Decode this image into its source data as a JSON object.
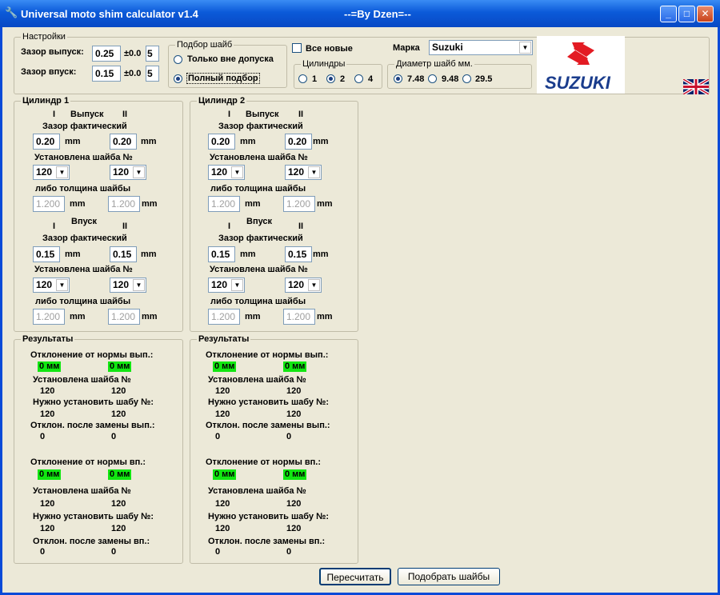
{
  "window": {
    "title": "Universal moto shim calculator v1.4",
    "by": "--=By Dzen=--"
  },
  "settings": {
    "legend": "Настройки",
    "exhaust_label": "Зазор выпуск:",
    "exhaust_value": "0.25",
    "exhaust_tol": "±0.0",
    "exhaust_tol_val": "5",
    "intake_label": "Зазор впуск:",
    "intake_value": "0.15",
    "intake_tol": "±0.0",
    "intake_tol_val": "5"
  },
  "selection": {
    "legend": "Подбор шайб",
    "opt1": "Только вне допуска",
    "opt2": "Полный подбор"
  },
  "all_new": "Все новые",
  "cylinders": {
    "legend": "Цилиндры",
    "options": [
      "1",
      "2",
      "4"
    ]
  },
  "brand": {
    "label": "Марка",
    "value": "Suzuki",
    "logo_text": "SUZUKI"
  },
  "diameter": {
    "legend": "Диаметр шайб мм.",
    "options": [
      "7.48",
      "9.48",
      "29.5"
    ]
  },
  "cyl1": {
    "legend": "Цилиндр 1",
    "c1": "I",
    "c2": "II",
    "exhaust": "Выпуск",
    "intake": "Впуск",
    "gap_label": "Зазор фактический",
    "shim_label": "Установлена шайба №",
    "thick_label": "либо толщина шайбы",
    "unit": "mm",
    "ex_gap1": "0.20",
    "ex_gap2": "0.20",
    "ex_shim1": "120",
    "ex_shim2": "120",
    "ex_thk1": "1.200",
    "ex_thk2": "1.200",
    "in_gap1": "0.15",
    "in_gap2": "0.15",
    "in_shim1": "120",
    "in_shim2": "120",
    "in_thk1": "1.200",
    "in_thk2": "1.200"
  },
  "cyl2": {
    "legend": "Цилиндр 2",
    "c1": "I",
    "c2": "II",
    "exhaust": "Выпуск",
    "intake": "Впуск",
    "gap_label": "Зазор фактический",
    "shim_label": "Установлена шайба №",
    "thick_label": "либо толщина шайбы",
    "unit": "mm",
    "ex_gap1": "0.20",
    "ex_gap2": "0.20",
    "ex_shim1": "120",
    "ex_shim2": "120",
    "ex_thk1": "1.200",
    "ex_thk2": "1.200",
    "in_gap1": "0.15",
    "in_gap2": "0.15",
    "in_shim1": "120",
    "in_shim2": "120",
    "in_thk1": "1.200",
    "in_thk2": "1.200"
  },
  "res1": {
    "legend": "Результаты",
    "dev_ex": "Отклонение от нормы вып.:",
    "installed": "Установлена шайба №",
    "need": "Нужно установить шабу №:",
    "after_ex": "Отклон. после замены вып.:",
    "dev_in": "Отклонение от нормы вп.:",
    "after_in": "Отклон. после замены вп.:",
    "badge": "0 мм",
    "v120": "120",
    "v0": "0"
  },
  "res2": {
    "legend": "Результаты",
    "dev_ex": "Отклонение от нормы вып.:",
    "installed": "Установлена шайба №",
    "need": "Нужно установить шабу №:",
    "after_ex": "Отклон. после замены вып.:",
    "dev_in": "Отклонение от нормы вп.:",
    "after_in": "Отклон. после замены вп.:",
    "badge": "0 мм",
    "v120": "120",
    "v0": "0"
  },
  "buttons": {
    "recalc": "Пересчитать",
    "pick": "Подобрать шайбы"
  },
  "colors": {
    "title_bar": "#0b5ad9",
    "window_bg": "#ece9d8",
    "ok_badge": "#11e611",
    "suzuki_red": "#e31b23",
    "suzuki_blue": "#1a3c8c"
  }
}
